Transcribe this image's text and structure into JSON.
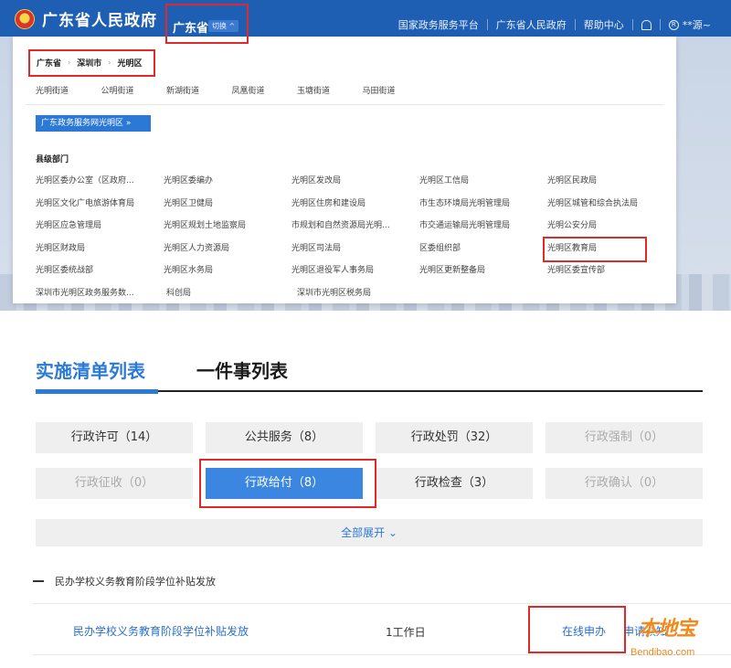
{
  "header": {
    "site_title": "广东省人民政府",
    "region": "广东省",
    "switch_label": "切换 ^",
    "nav": [
      "国家政务服务平台",
      "广东省人民政府",
      "帮助中心"
    ],
    "user": "**源~"
  },
  "dropdown": {
    "breadcrumb": [
      "广东省",
      "深圳市",
      "光明区"
    ],
    "streets": [
      "光明街道",
      "公明街道",
      "新湖街道",
      "凤凰街道",
      "玉塘街道",
      "马田街道"
    ],
    "gov_button": "广东政务服务网光明区 »",
    "dept_title": "县级部门",
    "departments": [
      [
        "光明区委办公室（区政府...",
        "光明区委编办",
        "光明区发改局",
        "光明区工信局",
        "光明区民政局"
      ],
      [
        "光明区文化广电旅游体育局",
        "光明区卫健局",
        "光明区住房和建设局",
        "市生态环境局光明管理局",
        "光明区城管和综合执法局"
      ],
      [
        "光明区应急管理局",
        "光明区规划土地监察局",
        "市规划和自然资源局光明...",
        "市交通运输局光明管理局",
        "光明公安分局"
      ],
      [
        "光明区财政局",
        "光明区人力资源局",
        "光明区司法局",
        "区委组织部",
        "光明区教育局"
      ],
      [
        "光明区委统战部",
        "光明区水务局",
        "光明区退役军人事务局",
        "光明区更新整备局",
        "光明区委宣传部"
      ],
      [
        "深圳市光明区政务服务数...",
        "科创局",
        "深圳市光明区税务局",
        "",
        ""
      ]
    ]
  },
  "tabs": {
    "active": "实施清单列表",
    "inactive": "一件事列表"
  },
  "categories": [
    {
      "label": "行政许可（14）",
      "state": "on"
    },
    {
      "label": "公共服务（8）",
      "state": "on"
    },
    {
      "label": "行政处罚（32）",
      "state": "on"
    },
    {
      "label": "行政强制（0）",
      "state": "off"
    },
    {
      "label": "行政征收（0）",
      "state": "off"
    },
    {
      "label": "行政给付（8）",
      "state": "selected"
    },
    {
      "label": "行政检查（3）",
      "state": "on"
    },
    {
      "label": "行政确认（0）",
      "state": "off"
    }
  ],
  "expand_all": "全部展开 ⌄",
  "group": {
    "title": "民办学校义务教育阶段学位补贴发放"
  },
  "item": {
    "name": "民办学校义务教育阶段学位补贴发放",
    "days": "1工作日",
    "online": "在线申办",
    "apply": "申请须知"
  },
  "watermark": {
    "logo": "本地宝",
    "url": "Bendibao.com"
  }
}
